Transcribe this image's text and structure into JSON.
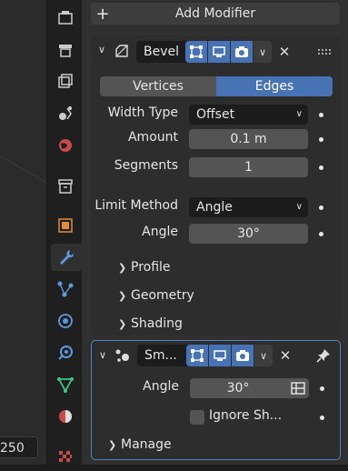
{
  "viewport": {
    "frame_value": "250"
  },
  "add_modifier": {
    "plus": "+",
    "label": "Add Modifier"
  },
  "bevel": {
    "name": "Bevel",
    "affect_options": [
      "Vertices",
      "Edges"
    ],
    "affect_selected": "Edges",
    "width_type": {
      "label": "Width Type",
      "value": "Offset"
    },
    "amount": {
      "label": "Amount",
      "value": "0.1 m"
    },
    "segments": {
      "label": "Segments",
      "value": "1"
    },
    "limit_method": {
      "label": "Limit Method",
      "value": "Angle"
    },
    "angle": {
      "label": "Angle",
      "value": "30°"
    },
    "subpanels": [
      "Profile",
      "Geometry",
      "Shading"
    ]
  },
  "smooth": {
    "name": "Sm...",
    "angle": {
      "label": "Angle",
      "value": "30°"
    },
    "ignore_sharp": {
      "label": "Ignore Sh...",
      "checked": false
    },
    "manage_label": "Manage"
  },
  "accent_color": "#4772b3"
}
